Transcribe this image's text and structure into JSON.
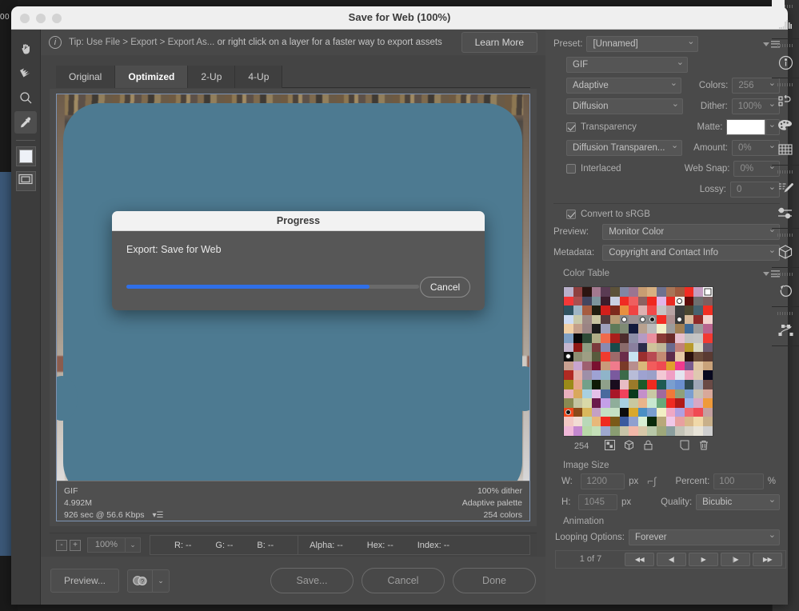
{
  "window": {
    "title": "Save for Web (100%)",
    "backdrop_ghost": "00"
  },
  "tipbar": {
    "icon": "info-icon",
    "tip_part1": "Tip: Use File > Export > Export As...",
    "tip_part2": "or right click on a layer for a faster way to export assets",
    "learn_more": "Learn More"
  },
  "tabs": [
    {
      "label": "Original",
      "selected": false
    },
    {
      "label": "Optimized",
      "selected": true
    },
    {
      "label": "2-Up",
      "selected": false
    },
    {
      "label": "4-Up",
      "selected": false
    }
  ],
  "tools": [
    {
      "name": "hand-tool",
      "icon": "hand-icon"
    },
    {
      "name": "slice-select-tool",
      "icon": "slice-select-icon"
    },
    {
      "name": "zoom-tool",
      "icon": "magnifier-icon"
    },
    {
      "name": "eyedropper-tool",
      "icon": "eyedropper-icon"
    },
    {
      "name": "foreground-color-swatch",
      "icon": "color-swatch-icon"
    },
    {
      "name": "toggle-slices-visibility",
      "icon": "slices-visibility-icon"
    }
  ],
  "image_info": {
    "format": "GIF",
    "file_size": "4.992M",
    "download_time": "926 sec @ 56.6 Kbps",
    "dither": "100% dither",
    "palette": "Adaptive palette",
    "colors": "254 colors"
  },
  "readout": {
    "zoom_out": "-",
    "zoom_in": "+",
    "zoom_level": "100%",
    "r": "R: --",
    "g": "G: --",
    "b": "B: --",
    "alpha": "Alpha: --",
    "hex": "Hex: --",
    "index": "Index: --"
  },
  "actionbar": {
    "preview": "Preview...",
    "browser_icon": "browser-preview-icon",
    "save": "Save...",
    "cancel": "Cancel",
    "done": "Done"
  },
  "settings": {
    "preset_label": "Preset:",
    "preset_value": "[Unnamed]",
    "panel_menu_icon": "panel-menu-icon",
    "format_value": "GIF",
    "reduction_value": "Adaptive",
    "colors_label": "Colors:",
    "colors_value": "256",
    "dither_algo_value": "Diffusion",
    "dither_label": "Dither:",
    "dither_value": "100%",
    "transparency_label": "Transparency",
    "transparency_checked": true,
    "matte_label": "Matte:",
    "matte_color": "#ffffff",
    "transparency_dither_value": "Diffusion Transparen...",
    "amount_label": "Amount:",
    "amount_value": "0%",
    "interlaced_label": "Interlaced",
    "interlaced_checked": false,
    "web_snap_label": "Web Snap:",
    "web_snap_value": "0%",
    "lossy_label": "Lossy:",
    "lossy_value": "0",
    "convert_srgb_label": "Convert to sRGB",
    "convert_srgb_checked": true,
    "preview_label": "Preview:",
    "preview_value": "Monitor Color",
    "metadata_label": "Metadata:",
    "metadata_value": "Copyright and Contact Info",
    "color_table_label": "Color Table",
    "color_count": "254",
    "ct_icons": [
      "transparency-icon",
      "web-shift-icon",
      "lock-icon",
      "new-color-icon",
      "delete-icon"
    ],
    "image_size_label": "Image Size",
    "w_label": "W:",
    "w_value": "1200",
    "w_unit": "px",
    "h_label": "H:",
    "h_value": "1045",
    "h_unit": "px",
    "link_icon": "chain-link-icon",
    "percent_label": "Percent:",
    "percent_value": "100",
    "percent_unit": "%",
    "quality_label": "Quality:",
    "quality_value": "Bicubic",
    "animation_label": "Animation",
    "looping_label": "Looping Options:",
    "looping_value": "Forever",
    "frame_counter": "1 of 7",
    "nav_buttons": [
      {
        "name": "first-frame-button",
        "glyph": "◀◀"
      },
      {
        "name": "previous-frame-button",
        "glyph": "◀|"
      },
      {
        "name": "play-button",
        "glyph": "▶"
      },
      {
        "name": "next-frame-button",
        "glyph": "|▶"
      },
      {
        "name": "last-frame-button",
        "glyph": "▶▶"
      }
    ]
  },
  "rail_icons": [
    [
      "histogram-icon"
    ],
    [
      "info-panel-icon"
    ],
    [
      "actions-icon",
      "swatches-palette-icon",
      "color-grid-icon"
    ],
    [
      "adjustments-brush-icon",
      "properties-sliders-icon"
    ],
    [
      "3d-cube-icon"
    ],
    [
      "history-icon"
    ],
    [
      "paths-icon"
    ]
  ],
  "modal": {
    "title": "Progress",
    "message": "Export: Save for Web",
    "cancel_label": "Cancel",
    "progress_percent": 83,
    "progress_color": "#2f6fe8"
  },
  "color_table": {
    "columns": 16,
    "rows": [
      [
        "#b9b0cb",
        "#8e4040",
        "#2c1410",
        "#a3798f",
        "#5a3b53",
        "#5c5239",
        "#8186a3",
        "#9a7591",
        "#c89d72",
        "#d7b082",
        "#6e718f",
        "#a87557",
        "#a05b3f",
        "#f22c22",
        "#c49dc0",
        "#ffffff"
      ],
      [
        "#f23838",
        "#a85050",
        "#43455f",
        "#7d959d",
        "#3c1d2c",
        "#c9d0e2",
        "#f02b23",
        "#ef5f5f",
        "#8c6161",
        "#ef2820",
        "#e2b6e8",
        "#ea2a22",
        "#f0efe8",
        "#5e0e0a",
        "#6e6e6e",
        "#7a5f5f"
      ],
      [
        "#2f5260",
        "#9fb5c4",
        "#a65c40",
        "#201d10",
        "#d31f1b",
        "#7d2a1c",
        "#e8903f",
        "#ef4343",
        "#ddb0b0",
        "#f04a4a",
        "#c5c5c5",
        "#b8a3a3",
        "#3d3d3d",
        "#4a4630",
        "#46626e",
        "#f22f22"
      ],
      [
        "#cddcf4",
        "#c7c8a9",
        "#9e8a86",
        "#c9c5a1",
        "#553b3d",
        "#b89a72",
        "#8a8a8a",
        "#9b8f92",
        "#8e8e8e",
        "#8a8a8a",
        "#f32c24",
        "#ac8f8f",
        "#3a3a3a",
        "#d7b99a",
        "#8e2b29",
        "#f3d2cd"
      ],
      [
        "#f0cfa4",
        "#c4a08a",
        "#9b8484",
        "#1c1c1c",
        "#9fa0bc",
        "#5f7a59",
        "#7e8a74",
        "#131a3c",
        "#b8a18f",
        "#bbbbbb",
        "#f2efc8",
        "#9b9b9b",
        "#a07f54",
        "#3f6a96",
        "#9b9b9b",
        "#b8648e"
      ],
      [
        "#7fa0c4",
        "#0a0a0a",
        "#2e4a36",
        "#b0ae86",
        "#f06a4b",
        "#a81f1b",
        "#4d2c2c",
        "#8e8fa8",
        "#b49bc4",
        "#eb8f9e",
        "#8a3a36",
        "#6a2a28",
        "#e7c0ce",
        "#c1c1c1",
        "#c4c4c4",
        "#f23a32"
      ],
      [
        "#c4b6cf",
        "#8e1714",
        "#8f9e83",
        "#7a3a3c",
        "#8a8ab0",
        "#1a4a4a",
        "#8a6b6b",
        "#8a7f9e",
        "#2c2c4a",
        "#cfc39a",
        "#bfb79a",
        "#6a6a8e",
        "#c2807a",
        "#b89a2c",
        "#d9d9c4",
        "#6a5a6e"
      ],
      [
        "#0d0d0d",
        "#8d8d72",
        "#9e9e84",
        "#585a3c",
        "#f03b2f",
        "#9e6a6a",
        "#6b2c4a",
        "#c7e2f0",
        "#9b2f2f",
        "#b84a52",
        "#c48a72",
        "#5c2a4a",
        "#e5c8a6",
        "#2a0f0d",
        "#6a4a3a",
        "#5a3a32"
      ],
      [
        "#c8a091",
        "#c8a5cf",
        "#9e6070",
        "#7a1030",
        "#c99a7a",
        "#f07b8c",
        "#7a3a28",
        "#b88e8e",
        "#d9b87a",
        "#f25c5c",
        "#ef4a52",
        "#e0a02c",
        "#f03a8e",
        "#7a5a8e",
        "#e0c4a2",
        "#c9a27a"
      ],
      [
        "#b02a22",
        "#e2b0a8",
        "#9e8fa8",
        "#9ea2d4",
        "#8fb4c9",
        "#7a5a9e",
        "#3c6a4a",
        "#b8bcd8",
        "#9ea2d0",
        "#9ba0c8",
        "#f2c8d4",
        "#f09ec4",
        "#e4e4ef",
        "#efa8c0",
        "#dfc8b0",
        "#08081e"
      ],
      [
        "#9b8a18",
        "#e4a58a",
        "#72a08a",
        "#0e1a06",
        "#8fa08a",
        "#1a0d1e",
        "#e8bcc4",
        "#9b7a2a",
        "#1e5a2a",
        "#f02a20",
        "#1e5a52",
        "#7a9ecf",
        "#6a8fcf",
        "#2f4a52",
        "#9ea6b8",
        "#6a4a46"
      ],
      [
        "#e8b0bc",
        "#d9a85c",
        "#a8d0e0",
        "#e4c0e8",
        "#4a6a9e",
        "#a81828",
        "#f0425c",
        "#0c3a1c",
        "#c490c9",
        "#c9c8a4",
        "#a06a9e",
        "#ef7a3a",
        "#8fa07a",
        "#7a9ecf",
        "#c8c0b0",
        "#d8a89a"
      ],
      [
        "#8a8a52",
        "#c4c4a0",
        "#d9d9a8",
        "#6a1a4a",
        "#c4a0e8",
        "#8fae9a",
        "#a8cfe0",
        "#c8c8a0",
        "#e8b48a",
        "#c8e8d0",
        "#6aa87a",
        "#f02a22",
        "#b01a18",
        "#9eb4e8",
        "#d8a8c4",
        "#ef9a3a"
      ],
      [
        "#f0481c",
        "#8a4a18",
        "#d9b85c",
        "#c4a0c4",
        "#c4e0c4",
        "#c4e0c4",
        "#0c0c0c",
        "#d9a82c",
        "#4a8fc4",
        "#7a9ecf",
        "#f2efc4",
        "#efa8c4",
        "#b0a0e0",
        "#f06a72",
        "#f04a52",
        "#c4a0a0"
      ],
      [
        "#f2c8c4",
        "#f2dcd4",
        "#b8d8b8",
        "#e8b87a",
        "#f02a20",
        "#7a5a18",
        "#3a5a9e",
        "#8fa0cf",
        "#d9f0d4",
        "#0a2a0a",
        "#b8a87a",
        "#f0c8e8",
        "#e8a0a0",
        "#d9b88a",
        "#f0d8a8",
        "#c8b08a"
      ],
      [
        "#f0b8d8",
        "#c488cf",
        "#b8d8a8",
        "#c4e0b8",
        "#9ea8cf",
        "#8a9e72",
        "#c8c4a8",
        "#f2b8a8",
        "#d8c8a8",
        "#b8c8a8",
        "#9ea87a",
        "#8a9e9e",
        "#c4c4b8",
        "#d8d4c8",
        "#e8e4d8",
        "#cfcfcf"
      ]
    ]
  }
}
